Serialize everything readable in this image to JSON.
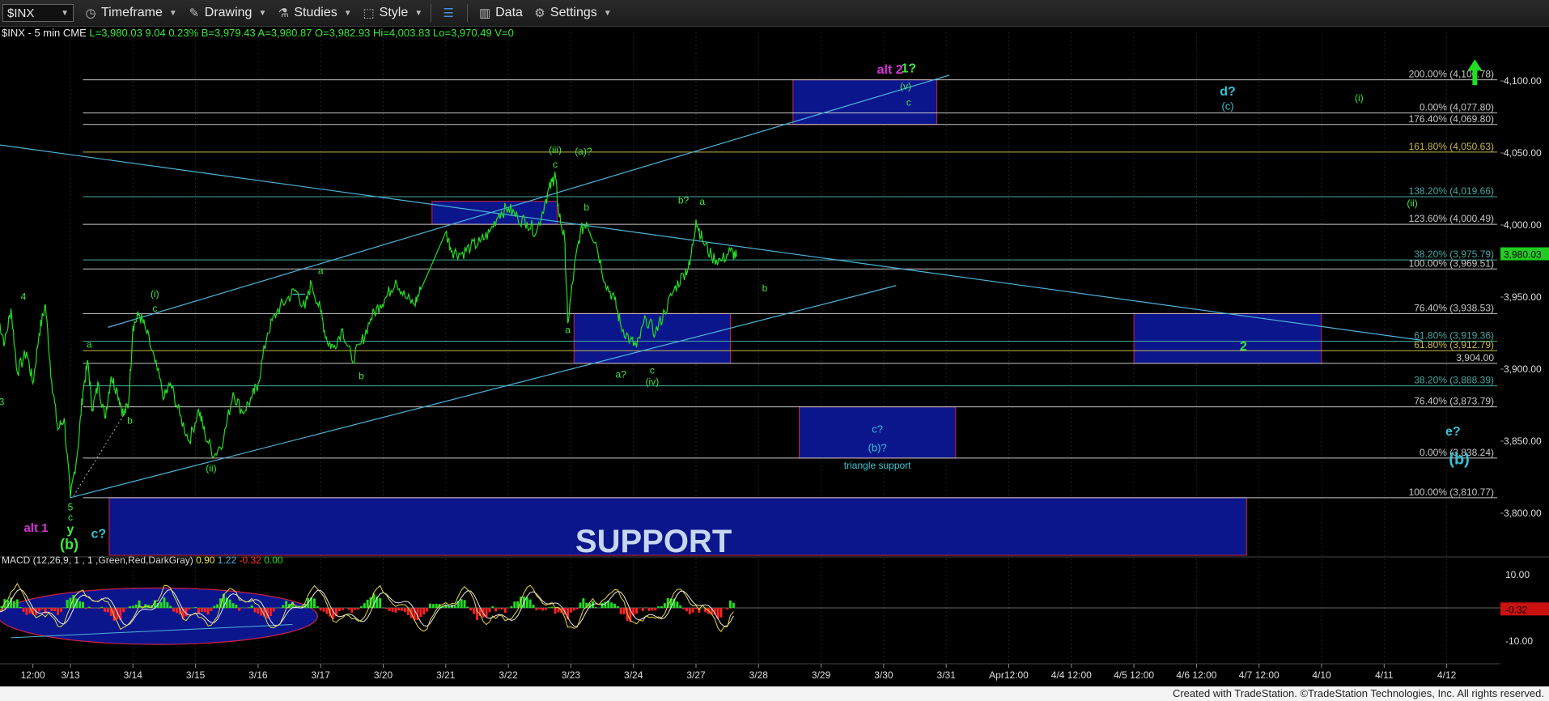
{
  "toolbar": {
    "symbol": "$INX",
    "items": [
      {
        "label": "Timeframe",
        "icon": "clock-icon"
      },
      {
        "label": "Drawing",
        "icon": "pencil-icon"
      },
      {
        "label": "Studies",
        "icon": "flask-icon"
      },
      {
        "label": "Style",
        "icon": "style-icon"
      },
      {
        "label": "",
        "icon": "layout-icon"
      },
      {
        "label": "Data",
        "icon": "bar-chart-icon"
      },
      {
        "label": "Settings",
        "icon": "gear-icon"
      }
    ]
  },
  "info_line": {
    "symbol": "$INX - 5 min  CME",
    "quote": "L=3,980.03  9.04  0.23%  B=3,979.43  A=3,980.87  O=3,982.93  Hi=4,003.83  Lo=3,970.49  V=0"
  },
  "footer_text": "Created with TradeStation. ©TradeStation Technologies, Inc. All rights reserved.",
  "colors": {
    "price": "#22dd22",
    "fib_line": "#8c8c8c",
    "trend_line": "#4fb3d9",
    "box_fill": "#0b168c",
    "box_border": "#cc2244",
    "axis_text": "#dddddd",
    "current_price_bg": "#22cc22"
  },
  "chart_data": {
    "type": "line",
    "title": "",
    "price_axis": {
      "ticks": [
        "4,100.00",
        "4,050.00",
        "4,000.00",
        "3,950.00",
        "3,900.00",
        "3,850.00",
        "3,800.00"
      ],
      "tick_values": [
        4100,
        4050,
        4000,
        3950,
        3900,
        3850,
        3800
      ],
      "current_price": "3,980.03",
      "current_value": 3980.03
    },
    "time_axis": {
      "labels": [
        "12:00",
        "3/13",
        "3/14",
        "3/15",
        "3/16",
        "3/17",
        "3/20",
        "3/21",
        "3/22",
        "3/23",
        "3/24",
        "3/27",
        "3/28",
        "3/29",
        "3/30",
        "3/31",
        "Apr12:00",
        "4/4 12:00",
        "4/5 12:00",
        "4/6 12:00",
        "4/7 12:00",
        "4/10",
        "4/11",
        "4/12"
      ],
      "index": [
        -0.6,
        0,
        1,
        2,
        3,
        4,
        5,
        6,
        7,
        8,
        9,
        10,
        11,
        12,
        13,
        14,
        15,
        16,
        17,
        18,
        19,
        20,
        21,
        22
      ]
    },
    "price_series": {
      "name": "",
      "points": [
        [
          -1.15,
          3935
        ],
        [
          -1.05,
          3918
        ],
        [
          -0.95,
          3942
        ],
        [
          -0.85,
          3898
        ],
        [
          -0.7,
          3912
        ],
        [
          -0.6,
          3890
        ],
        [
          -0.5,
          3925
        ],
        [
          -0.4,
          3945
        ],
        [
          -0.3,
          3892
        ],
        [
          -0.2,
          3858
        ],
        [
          -0.1,
          3866
        ],
        [
          0.0,
          3810.77
        ],
        [
          0.12,
          3845
        ],
        [
          0.2,
          3885
        ],
        [
          0.28,
          3905
        ],
        [
          0.35,
          3872
        ],
        [
          0.45,
          3890
        ],
        [
          0.55,
          3866
        ],
        [
          0.65,
          3895
        ],
        [
          0.75,
          3885
        ],
        [
          0.85,
          3868
        ],
        [
          0.93,
          3876
        ],
        [
          1.0,
          3930
        ],
        [
          1.1,
          3938
        ],
        [
          1.2,
          3928
        ],
        [
          1.35,
          3905
        ],
        [
          1.5,
          3880
        ],
        [
          1.6,
          3890
        ],
        [
          1.75,
          3868
        ],
        [
          1.9,
          3850
        ],
        [
          2.05,
          3872
        ],
        [
          2.15,
          3855
        ],
        [
          2.3,
          3840
        ],
        [
          2.45,
          3852
        ],
        [
          2.6,
          3884
        ],
        [
          2.75,
          3870
        ],
        [
          2.9,
          3880
        ],
        [
          3.0,
          3890
        ],
        [
          3.15,
          3925
        ],
        [
          3.3,
          3940
        ],
        [
          3.45,
          3948
        ],
        [
          3.6,
          3955
        ],
        [
          3.75,
          3942
        ],
        [
          3.85,
          3960
        ],
        [
          4.0,
          3940
        ],
        [
          4.1,
          3920
        ],
        [
          4.2,
          3915
        ],
        [
          4.35,
          3928
        ],
        [
          4.5,
          3906
        ],
        [
          4.65,
          3918
        ],
        [
          4.8,
          3935
        ],
        [
          4.95,
          3945
        ],
        [
          5.05,
          3950
        ],
        [
          5.2,
          3962
        ],
        [
          5.35,
          3950
        ],
        [
          5.5,
          3945
        ],
        [
          5.6,
          3955
        ],
        [
          6.0,
          3995
        ],
        [
          6.1,
          3982
        ],
        [
          6.25,
          3980
        ],
        [
          6.4,
          3985
        ],
        [
          6.55,
          3988
        ],
        [
          6.7,
          3995
        ],
        [
          6.85,
          4008
        ],
        [
          7.0,
          4012
        ],
        [
          7.15,
          4005
        ],
        [
          7.3,
          4002
        ],
        [
          7.45,
          3995
        ],
        [
          7.6,
          4018
        ],
        [
          7.7,
          4030
        ],
        [
          7.75,
          4035
        ],
        [
          7.8,
          4010
        ],
        [
          7.9,
          3990
        ],
        [
          7.95,
          3932
        ],
        [
          8.05,
          3968
        ],
        [
          8.15,
          3995
        ],
        [
          8.25,
          4002
        ],
        [
          8.4,
          3988
        ],
        [
          8.55,
          3960
        ],
        [
          8.7,
          3948
        ],
        [
          8.8,
          3930
        ],
        [
          8.95,
          3920
        ],
        [
          9.05,
          3915
        ],
        [
          9.2,
          3935
        ],
        [
          9.35,
          3925
        ],
        [
          9.5,
          3940
        ],
        [
          9.65,
          3955
        ],
        [
          9.8,
          3966
        ],
        [
          9.9,
          3972
        ],
        [
          10.0,
          4003.83
        ],
        [
          10.1,
          3990
        ],
        [
          10.25,
          3978
        ],
        [
          10.4,
          3975
        ],
        [
          10.55,
          3982
        ],
        [
          10.65,
          3978
        ]
      ]
    },
    "fib_levels": [
      {
        "label": "200.00% (4,100.78)",
        "value": 4100.78,
        "color": "#c8c8c8"
      },
      {
        "label": "0.00% (4,077.80)",
        "value": 4077.8,
        "color": "#c8c8c8"
      },
      {
        "label": "176.40% (4,069.80)",
        "value": 4069.8,
        "color": "#c8c8c8"
      },
      {
        "label": "161.80% (4,050.63)",
        "value": 4050.63,
        "color": "#c8b84a"
      },
      {
        "label": "138.20% (4,019.66)",
        "value": 4019.66,
        "color": "#47a6a0"
      },
      {
        "label": "123.60% (4,000.49)",
        "value": 4000.49,
        "color": "#c8c8c8"
      },
      {
        "label": "38.20% (3,975.79)",
        "value": 3975.79,
        "color": "#47a6a0"
      },
      {
        "label": "100.00% (3,969.51)",
        "value": 3969.51,
        "color": "#c8c8c8"
      },
      {
        "label": "76.40% (3,938.53)",
        "value": 3938.53,
        "color": "#c8c8c8"
      },
      {
        "label": "61.80% (3,919.36)",
        "value": 3919.36,
        "color": "#47a6a0"
      },
      {
        "label": "61.80% (3,912.79)",
        "value": 3912.79,
        "color": "#c8b84a"
      },
      {
        "label": "3,904.00",
        "value": 3904.0,
        "color": "#c8c8c8"
      },
      {
        "label": "38.20% (3,888.39)",
        "value": 3888.39,
        "color": "#47a6a0"
      },
      {
        "label": "76.40% (3,873.79)",
        "value": 3873.79,
        "color": "#c8c8c8"
      },
      {
        "label": "0.00% (3,838.24)",
        "value": 3838.24,
        "color": "#c8c8c8"
      },
      {
        "label": "100.00% (3,810.77)",
        "value": 3810.77,
        "color": "#c8c8c8"
      }
    ],
    "zones": [
      {
        "from_index": 11.55,
        "to_index": 13.85,
        "top": 4100.78,
        "bottom": 4069.8,
        "label": ""
      },
      {
        "from_index": 5.78,
        "to_index": 7.78,
        "top": 4016.5,
        "bottom": 4000.49,
        "label": ""
      },
      {
        "from_index": 8.05,
        "to_index": 10.55,
        "top": 3938.53,
        "bottom": 3904.0,
        "label": ""
      },
      {
        "from_index": 17.0,
        "to_index": 20.0,
        "top": 3938.53,
        "bottom": 3904.0,
        "label": ""
      },
      {
        "from_index": 11.65,
        "to_index": 14.15,
        "top": 3873.79,
        "bottom": 3838.24,
        "label": ""
      },
      {
        "from_index": 0.62,
        "to_index": 18.8,
        "top": 3810.77,
        "bottom": 3770,
        "label": "SUPPORT"
      }
    ],
    "trend_lines": [
      [
        -1.2,
        4056,
        21.6,
        3920
      ],
      [
        0.0,
        3810.77,
        13.2,
        3958
      ],
      [
        0.6,
        3929,
        14.05,
        4104
      ],
      [
        3.55,
        3952.0,
        3.75,
        3952.0
      ]
    ],
    "wave_labels": [
      {
        "text": "alt 2",
        "i": 13.1,
        "v": 4105,
        "color": "#d633d6",
        "size": 16
      },
      {
        "text": "1?",
        "i": 13.4,
        "v": 4106,
        "color": "#3ee83e",
        "size": 16
      },
      {
        "text": "(v)",
        "i": 13.35,
        "v": 4094,
        "color": "#3ee83e",
        "size": 12
      },
      {
        "text": "c",
        "i": 13.4,
        "v": 4083,
        "color": "#3ee83e",
        "size": 12
      },
      {
        "text": "d?",
        "i": 18.5,
        "v": 4090,
        "color": "#33c4d4",
        "size": 16
      },
      {
        "text": "(c)",
        "i": 18.5,
        "v": 4080,
        "color": "#33c4d4",
        "size": 13
      },
      {
        "text": "(i)",
        "i": 20.6,
        "v": 4086,
        "color": "#3ee83e",
        "size": 12
      },
      {
        "text": "(ii)",
        "i": 21.45,
        "v": 4013,
        "color": "#3ee83e",
        "size": 12
      },
      {
        "text": "2",
        "i": 18.75,
        "v": 3913,
        "color": "#3ee83e",
        "size": 16
      },
      {
        "text": "e?",
        "i": 22.1,
        "v": 3854,
        "color": "#33c4d4",
        "size": 16
      },
      {
        "text": "(b)",
        "i": 22.2,
        "v": 3834,
        "color": "#33c4d4",
        "size": 20
      },
      {
        "text": "(iii)",
        "i": 7.75,
        "v": 4050,
        "color": "#3ee83e",
        "size": 12
      },
      {
        "text": "c",
        "i": 7.75,
        "v": 4040,
        "color": "#3ee83e",
        "size": 12
      },
      {
        "text": "(a)?",
        "i": 8.2,
        "v": 4049,
        "color": "#3ee83e",
        "size": 12
      },
      {
        "text": "b",
        "i": 8.25,
        "v": 4010,
        "color": "#3ee83e",
        "size": 12
      },
      {
        "text": "b?",
        "i": 9.8,
        "v": 4015,
        "color": "#3ee83e",
        "size": 12
      },
      {
        "text": "a",
        "i": 10.1,
        "v": 4014,
        "color": "#3ee83e",
        "size": 12
      },
      {
        "text": "b",
        "i": 11.1,
        "v": 3954,
        "color": "#3ee83e",
        "size": 12
      },
      {
        "text": "a",
        "i": 7.95,
        "v": 3925,
        "color": "#3ee83e",
        "size": 12
      },
      {
        "text": "a?",
        "i": 8.8,
        "v": 3894,
        "color": "#3ee83e",
        "size": 12
      },
      {
        "text": "c",
        "i": 9.3,
        "v": 3897,
        "color": "#3ee83e",
        "size": 12
      },
      {
        "text": "(iv)",
        "i": 9.3,
        "v": 3889,
        "color": "#3ee83e",
        "size": 12
      },
      {
        "text": "a",
        "i": 4.0,
        "v": 3966,
        "color": "#3ee83e",
        "size": 12
      },
      {
        "text": "b",
        "i": 4.65,
        "v": 3893,
        "color": "#3ee83e",
        "size": 12
      },
      {
        "text": "(i)",
        "i": 1.35,
        "v": 3950,
        "color": "#3ee83e",
        "size": 12
      },
      {
        "text": "c",
        "i": 1.35,
        "v": 3940,
        "color": "#3ee83e",
        "size": 12
      },
      {
        "text": "b",
        "i": 0.95,
        "v": 3862,
        "color": "#3ee83e",
        "size": 12
      },
      {
        "text": "(ii)",
        "i": 2.25,
        "v": 3829,
        "color": "#3ee83e",
        "size": 12
      },
      {
        "text": "a",
        "i": 0.3,
        "v": 3915,
        "color": "#3ee83e",
        "size": 12
      },
      {
        "text": "4",
        "i": -0.75,
        "v": 3948,
        "color": "#3ee83e",
        "size": 12
      },
      {
        "text": "3",
        "i": -1.1,
        "v": 3875,
        "color": "#3ee83e",
        "size": 12
      },
      {
        "text": "5",
        "i": 0.0,
        "v": 3802,
        "color": "#3ee83e",
        "size": 12
      },
      {
        "text": "c",
        "i": 0.0,
        "v": 3795,
        "color": "#3ee83e",
        "size": 12
      },
      {
        "text": "y",
        "i": 0.0,
        "v": 3786,
        "color": "#3ee83e",
        "size": 16
      },
      {
        "text": "(b)",
        "i": -0.02,
        "v": 3775,
        "color": "#3ee83e",
        "size": 18
      },
      {
        "text": "alt 1",
        "i": -0.55,
        "v": 3787,
        "color": "#d633d6",
        "size": 15
      },
      {
        "text": "c?",
        "i": 0.45,
        "v": 3783,
        "color": "#33c4d4",
        "size": 16
      },
      {
        "text": "c?",
        "i": 12.9,
        "v": 3856,
        "color": "#33c4d4",
        "size": 13
      },
      {
        "text": "(b)?",
        "i": 12.9,
        "v": 3843,
        "color": "#33c4d4",
        "size": 13
      },
      {
        "text": "triangle support",
        "i": 12.9,
        "v": 3831,
        "color": "#33c4d4",
        "size": 12
      }
    ],
    "up_arrow": {
      "i": 22.45,
      "v": 4115,
      "color": "#22dd22"
    },
    "macd": {
      "name": "MACD (12,26,9, 1 , 1 ,Green,Red,DarkGray)",
      "values_text": [
        "0.90",
        "1.22",
        "-0.32",
        "0.00"
      ],
      "values_colors": [
        "#e6e64a",
        "#4fb3d9",
        "#ff3333",
        "#22dd22"
      ],
      "ticks": [
        "10.00",
        "-10.00"
      ],
      "tick_values": [
        10,
        -10
      ],
      "ylim": [
        -14,
        14
      ],
      "current": "-0.32",
      "current_value": -0.32,
      "highlight_ellipse": {
        "from_index": -1.15,
        "to_index": 3.95,
        "top": 6,
        "bottom": -11
      }
    }
  }
}
